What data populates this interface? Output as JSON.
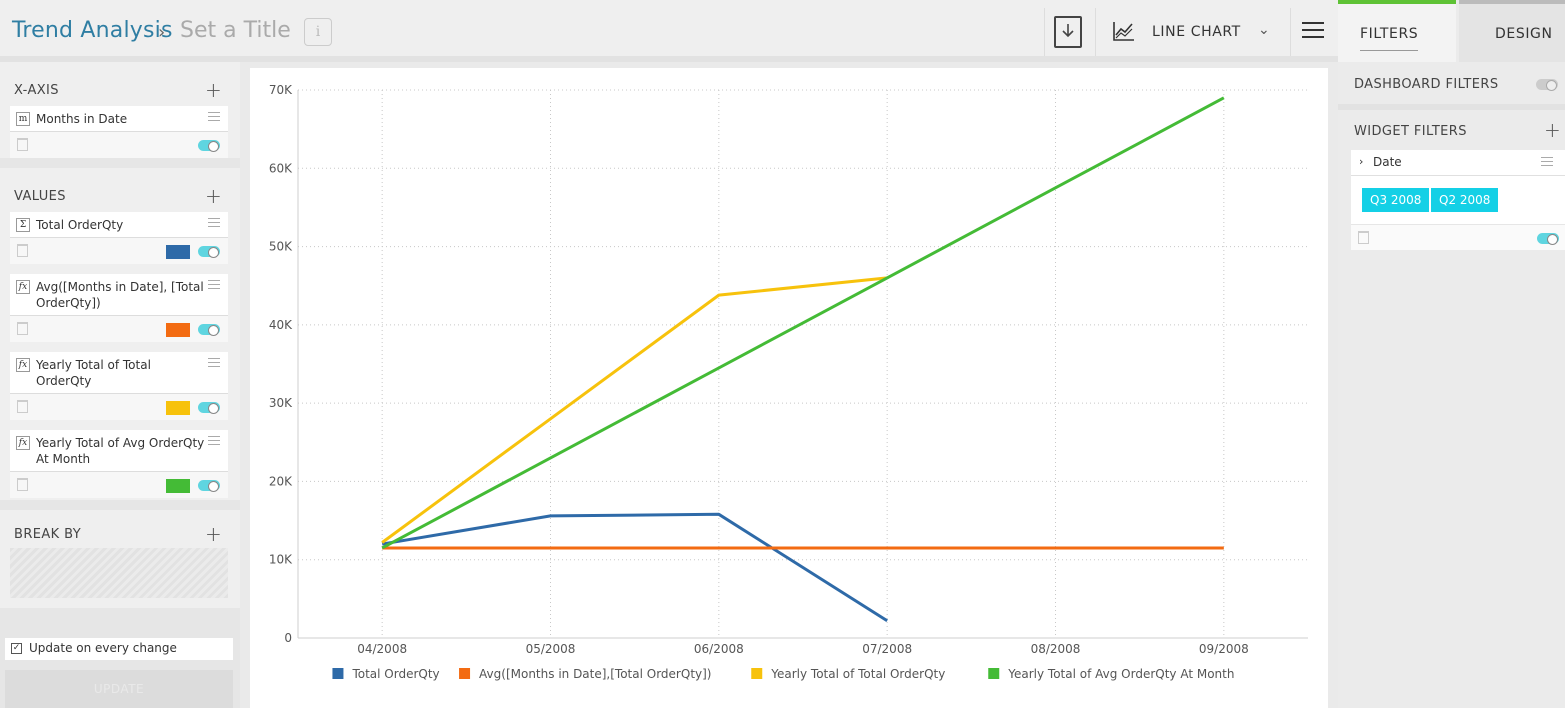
{
  "header": {
    "breadcrumb_root": "Trend Analysis",
    "breadcrumb_sep": "›",
    "title_placeholder": "Set a Title",
    "info_label": "i",
    "chart_type_label": "LINE CHART",
    "chart_type_chevron": "⌄"
  },
  "right_tabs": {
    "filters": "FILTERS",
    "design": "DESIGN"
  },
  "left_panel": {
    "xaxis": {
      "title": "X-AXIS",
      "items": [
        {
          "icon": "m",
          "label": "Months in Date"
        }
      ]
    },
    "values": {
      "title": "VALUES",
      "items": [
        {
          "icon": "Σ",
          "label": "Total OrderQty",
          "color": "#2e6aa8"
        },
        {
          "icon": "fx",
          "label": "Avg([Months in Date], [Total OrderQty])",
          "color": "#f36b12"
        },
        {
          "icon": "fx",
          "label": "Yearly Total of Total OrderQty",
          "color": "#f7c20c"
        },
        {
          "icon": "fx",
          "label": "Yearly Total of Avg OrderQty At Month",
          "color": "#44bb36"
        }
      ]
    },
    "breakby": {
      "title": "BREAK BY"
    },
    "update_on_change": {
      "label": "Update on every change",
      "checked": true
    },
    "update_button": "UPDATE"
  },
  "right_panel": {
    "dashboard_filters": "DASHBOARD FILTERS",
    "widget_filters": "WIDGET FILTERS",
    "filter": {
      "field": "Date",
      "chips": [
        "Q3 2008",
        "Q2 2008"
      ]
    }
  },
  "chart_data": {
    "type": "line",
    "categories": [
      "04/2008",
      "05/2008",
      "06/2008",
      "07/2008",
      "08/2008",
      "09/2008"
    ],
    "ylim": [
      0,
      70000
    ],
    "yticks": [
      "0",
      "10K",
      "20K",
      "30K",
      "40K",
      "50K",
      "60K",
      "70K"
    ],
    "grid": true,
    "legend_position": "bottom",
    "series": [
      {
        "name": "Total OrderQty",
        "color": "#2e6aa8",
        "values": [
          12000,
          15600,
          15800,
          2200,
          null,
          null
        ]
      },
      {
        "name": "Avg([Months in Date],[Total OrderQty])",
        "color": "#f36b12",
        "values": [
          11500,
          11500,
          11500,
          11500,
          11500,
          11500
        ]
      },
      {
        "name": "Yearly Total of Total OrderQty",
        "color": "#f7c20c",
        "values": [
          12200,
          28000,
          43800,
          46000,
          null,
          null
        ]
      },
      {
        "name": "Yearly Total of Avg OrderQty At Month",
        "color": "#44bb36",
        "values": [
          11500,
          23000,
          34500,
          46000,
          57500,
          69000
        ]
      }
    ]
  }
}
